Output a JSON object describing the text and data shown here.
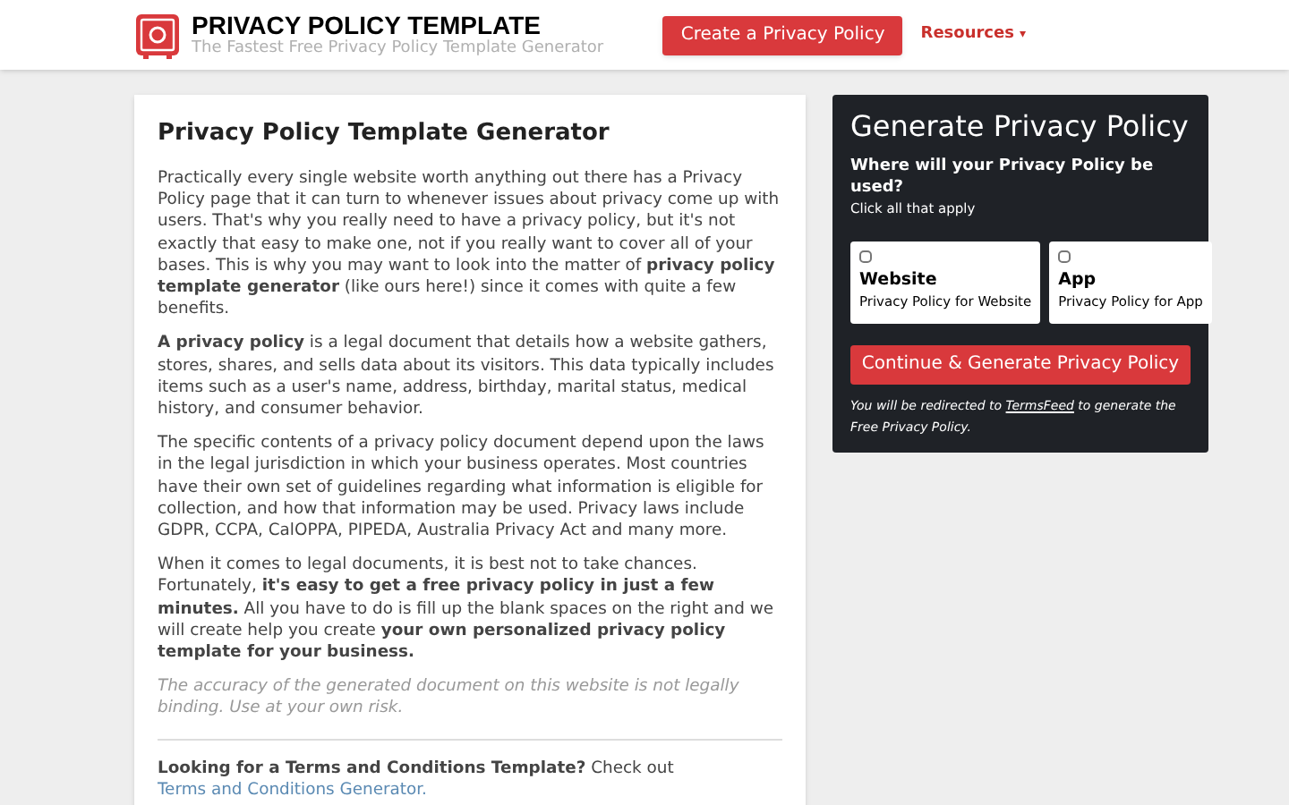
{
  "header": {
    "title": "PRIVACY POLICY TEMPLATE",
    "tagline": "The Fastest Free Privacy Policy Template Generator",
    "cta": "Create a Privacy Policy",
    "menu": "Resources",
    "menu_caret": "▾"
  },
  "article": {
    "title": "Privacy Policy Template Generator",
    "paragraphs": [
      "Practically every single website worth anything out there has a Privacy Policy page that it can turn to whenever issues about privacy come up with users. That's why you really need to have a privacy policy, but it's not exactly that easy to make one, not if you really want to cover all of your bases. This is why you may want to look into the matter of **privacy policy template generator** (like ours here!) since it comes with quite a few benefits.",
      "**A privacy policy** is a legal document that details how a website gathers, stores, shares, and sells data about its visitors. This data typically includes items such as a user's name, address, birthday, marital status, medical history, and consumer behavior.",
      "The specific contents of a privacy policy document depend upon the laws in the legal jurisdiction in which your business operates. Most countries have their own set of guidelines regarding what information is eligible for collection, and how that information may be used. Privacy laws include GDPR, CCPA, CalOPPA, PIPEDA, Australia Privacy Act and many more.",
      "When it comes to legal documents, it is best not to take chances. Fortunately, **it's easy to get a free privacy policy in just a few minutes.** All you have to do is fill up the blank spaces on the right and we will create help you create **your own personalized privacy policy template for your business.**"
    ],
    "disclaimer": "The accuracy of the generated document on this website is not legally binding. Use at your own risk.",
    "footer_text": "**Looking for a Terms and Conditions Template?** Check out",
    "footer_link": "Terms and Conditions Generator."
  },
  "generator": {
    "title": "Generate Privacy Policy",
    "question": "Where will your Privacy Policy be used?",
    "hint": "Click all that apply",
    "options": [
      {
        "label": "Website",
        "description": "Privacy Policy for Website",
        "checked": false
      },
      {
        "label": "App",
        "description": "Privacy Policy for App",
        "checked": false
      }
    ],
    "button": "Continue & Generate Privacy Policy",
    "note_before": "You will be redirected to",
    "note_link": "TermsFeed",
    "note_after": "to generate the Free Privacy Policy."
  }
}
